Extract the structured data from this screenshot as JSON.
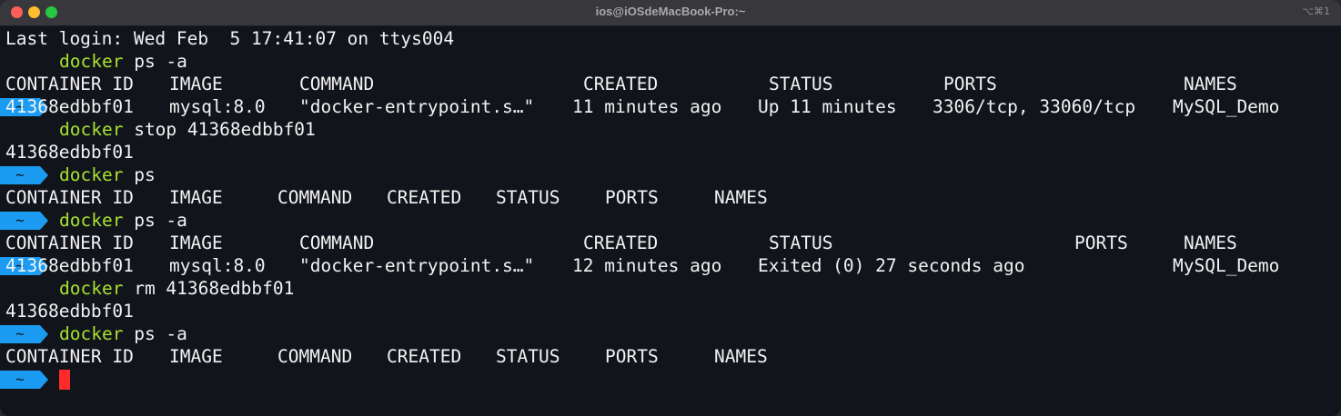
{
  "window": {
    "title": "ios@iOSdeMacBook-Pro:~",
    "shortcut": "⌥⌘1"
  },
  "prompt": {
    "symbol": "~",
    "badge_color": "#1b9cf2"
  },
  "terminal": {
    "last_login": "Last login: Wed Feb  5 17:41:07 on ttys004",
    "cmd1": {
      "name": "docker",
      "args": "ps -a"
    },
    "table1": {
      "headers": [
        "CONTAINER ID",
        "IMAGE",
        "COMMAND",
        "CREATED",
        "STATUS",
        "PORTS",
        "NAMES"
      ],
      "row": [
        "41368edbbf01",
        "mysql:8.0",
        "\"docker-entrypoint.s…\"",
        "11 minutes ago",
        "Up 11 minutes",
        "3306/tcp, 33060/tcp",
        "MySQL_Demo"
      ]
    },
    "cmd2": {
      "name": "docker",
      "args": "stop 41368edbbf01"
    },
    "out2": "41368edbbf01",
    "cmd3": {
      "name": "docker",
      "args": "ps"
    },
    "table3": {
      "headers": [
        "CONTAINER ID",
        "IMAGE",
        "COMMAND",
        "CREATED",
        "STATUS",
        "PORTS",
        "NAMES"
      ]
    },
    "cmd4": {
      "name": "docker",
      "args": "ps -a"
    },
    "table4": {
      "headers": [
        "CONTAINER ID",
        "IMAGE",
        "COMMAND",
        "CREATED",
        "STATUS",
        "PORTS",
        "NAMES"
      ],
      "row": [
        "41368edbbf01",
        "mysql:8.0",
        "\"docker-entrypoint.s…\"",
        "12 minutes ago",
        "Exited (0) 27 seconds ago",
        "MySQL_Demo"
      ]
    },
    "cmd5": {
      "name": "docker",
      "args": "rm 41368edbbf01"
    },
    "out5": "41368edbbf01",
    "cmd6": {
      "name": "docker",
      "args": "ps -a"
    },
    "table6": {
      "headers": [
        "CONTAINER ID",
        "IMAGE",
        "COMMAND",
        "CREATED",
        "STATUS",
        "PORTS",
        "NAMES"
      ]
    }
  },
  "colors": {
    "background": "#12141b",
    "command_green": "#a6e22e",
    "cursor_red": "#ff2a2a"
  }
}
